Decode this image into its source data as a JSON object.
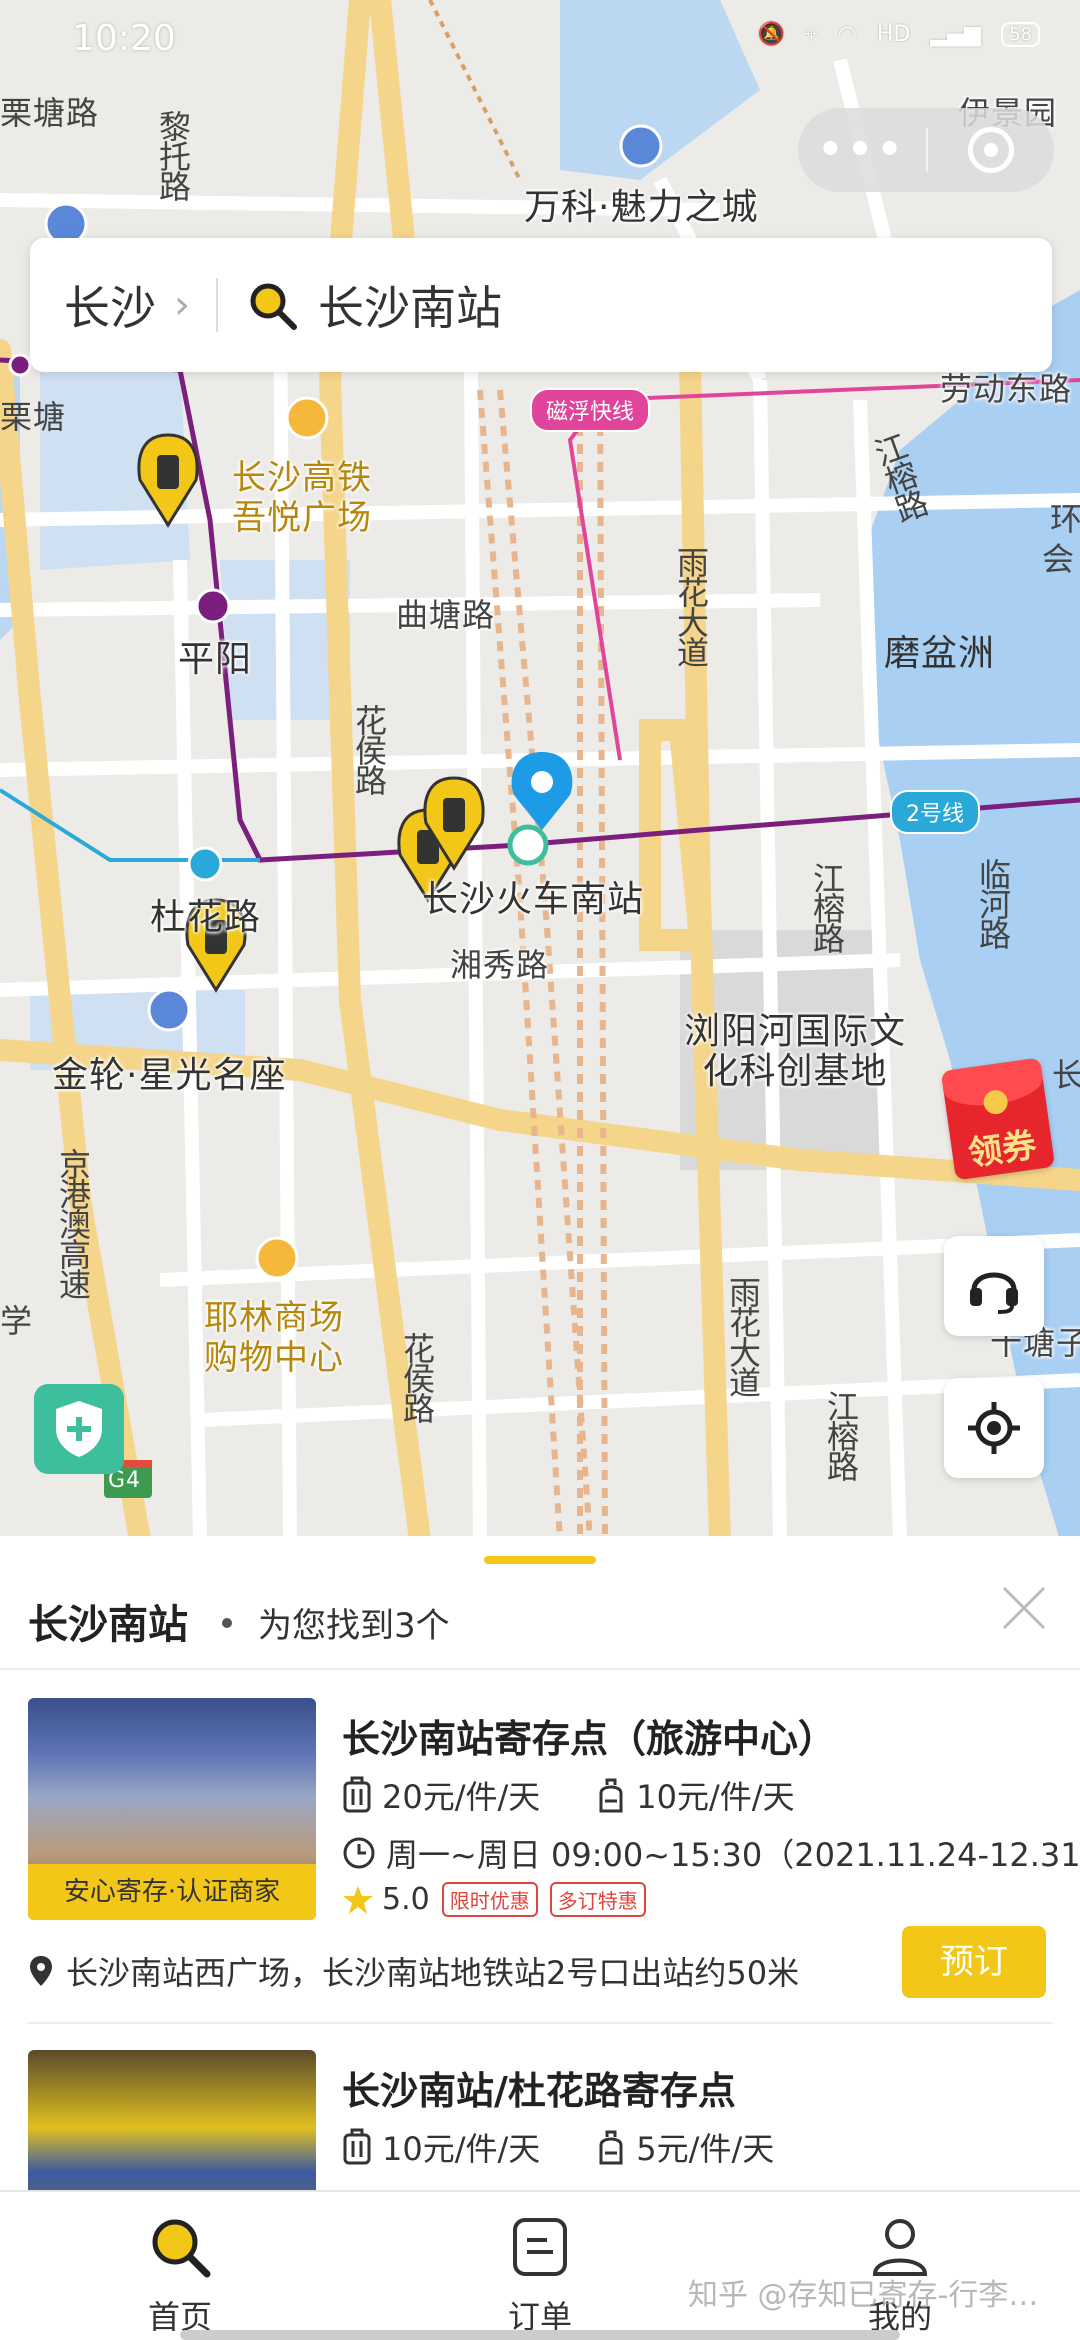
{
  "status_bar": {
    "time": "10:20",
    "icons": [
      "mute-icon",
      "location-icon",
      "wifi-icon",
      "hd-icon",
      "signal-icon"
    ],
    "battery": "58"
  },
  "search": {
    "city": "长沙",
    "query": "长沙南站"
  },
  "map": {
    "labels": {
      "litang_top": "栗塘路",
      "litang": "栗塘",
      "yijing": "伊景园",
      "vanke": "万科·魅力之城",
      "lishi": "黎托路",
      "maglev": "磁浮快线",
      "laodong": "劳动东路",
      "wuyue": "长沙高铁吾悦广场",
      "jiangrong_n": "江榕路",
      "huan": "环",
      "hui": "会",
      "pingyang": "平阳",
      "qutang": "曲塘路",
      "yuhua_n": "雨花大道",
      "mopenzhou": "磨盆洲",
      "huahou_n": "花侯路",
      "line2": "2号线",
      "duhua": "杜花路",
      "south_station": "长沙火车南站",
      "xiangxiu": "湘秀路",
      "jiangrong_m": "江榕路",
      "linhe": "临河路",
      "liuyang": "浏阳河国际文化科创基地",
      "jinlun": "金轮·星光名座",
      "chang": "长",
      "jinggang": "京港澳高速",
      "yelin": "耶林商场购物中心",
      "huahou_s": "花侯路",
      "yuhua_s": "雨花大道",
      "jiangrong_s": "江榕路",
      "shitangzi": "十塘子",
      "xue": "学",
      "g4": "G4"
    },
    "coupon_label": "领券"
  },
  "sheet": {
    "title": "长沙南站",
    "found": "为您找到3个",
    "stores": [
      {
        "name": "长沙南站寄存点（旅游中心）",
        "price_suitcase": "20元/件/天",
        "price_bag": "10元/件/天",
        "hours": "周一~周日 09:00~15:30（2021.11.24-12.31…",
        "rating": "5.0",
        "tags": [
          "限时优惠",
          "多订特惠"
        ],
        "ribbon": "安心寄存·认证商家",
        "address": "长沙南站西广场，长沙南站地铁站2号口出站约50米",
        "book": "预订"
      },
      {
        "name": "长沙南站/杜花路寄存点",
        "price_suitcase": "10元/件/天",
        "price_bag": "5元/件/天"
      }
    ]
  },
  "tabs": [
    {
      "label": "首页",
      "icon": "search-icon"
    },
    {
      "label": "订单",
      "icon": "order-icon"
    },
    {
      "label": "我的",
      "icon": "user-icon"
    }
  ],
  "watermark": "知乎 @存知已寄存-行李…",
  "colors": {
    "accent": "#f2c718",
    "metro_purple": "#7b1f7e",
    "maglev_pink": "#e0459b",
    "river": "#a9cff3",
    "road_major": "#f5d58a"
  }
}
